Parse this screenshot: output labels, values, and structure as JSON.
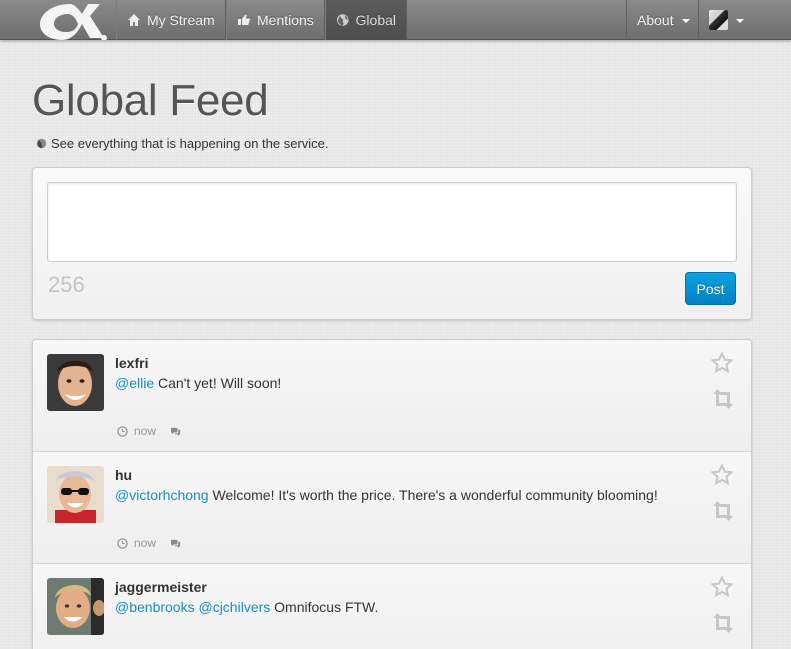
{
  "nav": {
    "brand_icon": "alpha-logo-icon",
    "items": [
      {
        "label": "My Stream",
        "icon": "home-icon"
      },
      {
        "label": "Mentions",
        "icon": "hand-point-icon"
      },
      {
        "label": "Global",
        "icon": "globe-icon"
      }
    ],
    "about_label": "About"
  },
  "header": {
    "title": "Global Feed",
    "subtitle": "See everything that is happening on the service."
  },
  "compose": {
    "textarea_value": "",
    "char_count": "256",
    "post_label": "Post"
  },
  "posts": [
    {
      "username": "lexfri",
      "mentions": [
        "@ellie"
      ],
      "text": "Can't yet! Will soon!",
      "time": "now"
    },
    {
      "username": "hu",
      "mentions": [
        "@victorhchong"
      ],
      "text": "Welcome! It's worth the price. There's a wonderful community blooming!",
      "time": "now"
    },
    {
      "username": "jaggermeister",
      "mentions": [
        "@benbrooks",
        "@cjchilvers"
      ],
      "text": "Omnifocus FTW.",
      "time": "now"
    }
  ],
  "colors": {
    "accent": "#0a8fd4",
    "mention": "#1a8cc6",
    "navbar": "#7a7a7a"
  }
}
